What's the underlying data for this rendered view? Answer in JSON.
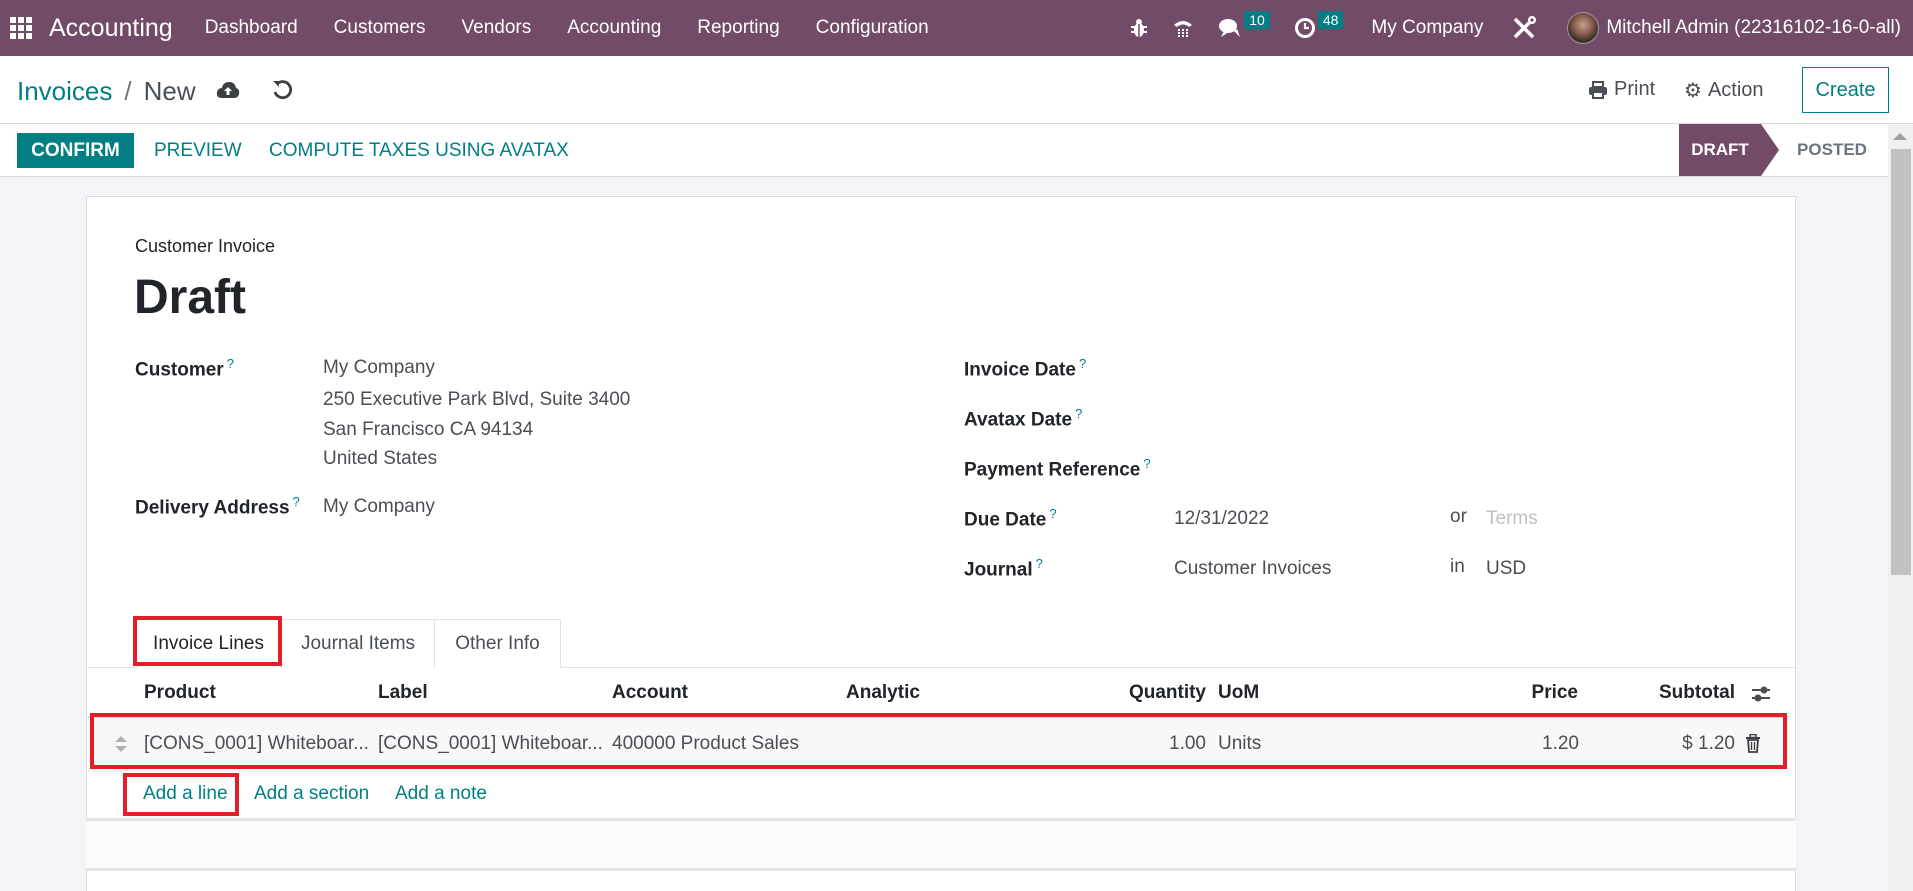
{
  "navbar": {
    "app_name": "Accounting",
    "menu": [
      "Dashboard",
      "Customers",
      "Vendors",
      "Accounting",
      "Reporting",
      "Configuration"
    ],
    "messages_count": "10",
    "activities_count": "48",
    "company": "My Company",
    "user": "Mitchell Admin (22316102-16-0-all)"
  },
  "breadcrumb": {
    "parent": "Invoices",
    "separator": "/",
    "current": "New"
  },
  "toolbar": {
    "print": "Print",
    "action": "Action",
    "create": "Create"
  },
  "statusbar": {
    "confirm": "CONFIRM",
    "preview": "PREVIEW",
    "compute_taxes": "COMPUTE TAXES USING AVATAX",
    "stages": [
      "DRAFT",
      "POSTED"
    ],
    "current_stage": "DRAFT"
  },
  "form": {
    "doc_type": "Customer Invoice",
    "title": "Draft",
    "customer_label": "Customer",
    "customer_name": "My Company",
    "customer_address": [
      "250 Executive Park Blvd, Suite 3400",
      "San Francisco CA 94134",
      "United States"
    ],
    "delivery_label": "Delivery Address",
    "delivery_value": "My Company",
    "invoice_date_label": "Invoice Date",
    "avatax_date_label": "Avatax Date",
    "payment_ref_label": "Payment Reference",
    "due_date_label": "Due Date",
    "due_date_value": "12/31/2022",
    "or": "or",
    "terms_placeholder": "Terms",
    "journal_label": "Journal",
    "journal_value": "Customer Invoices",
    "in": "in",
    "currency": "USD",
    "help_mark": "?"
  },
  "tabs": [
    "Invoice Lines",
    "Journal Items",
    "Other Info"
  ],
  "table": {
    "columns": [
      "Product",
      "Label",
      "Account",
      "Analytic",
      "Quantity",
      "UoM",
      "Price",
      "Subtotal"
    ],
    "rows": [
      {
        "product": "[CONS_0001] Whiteboar...",
        "label": "[CONS_0001] Whiteboar...",
        "account": "400000 Product Sales",
        "analytic": "",
        "quantity": "1.00",
        "uom": "Units",
        "price": "1.20",
        "subtotal": "$ 1.20"
      }
    ],
    "add_line": "Add a line",
    "add_section": "Add a section",
    "add_note": "Add a note"
  },
  "colors": {
    "brand": "#714b67",
    "accent": "#017e84",
    "highlight": "#e41e26"
  }
}
